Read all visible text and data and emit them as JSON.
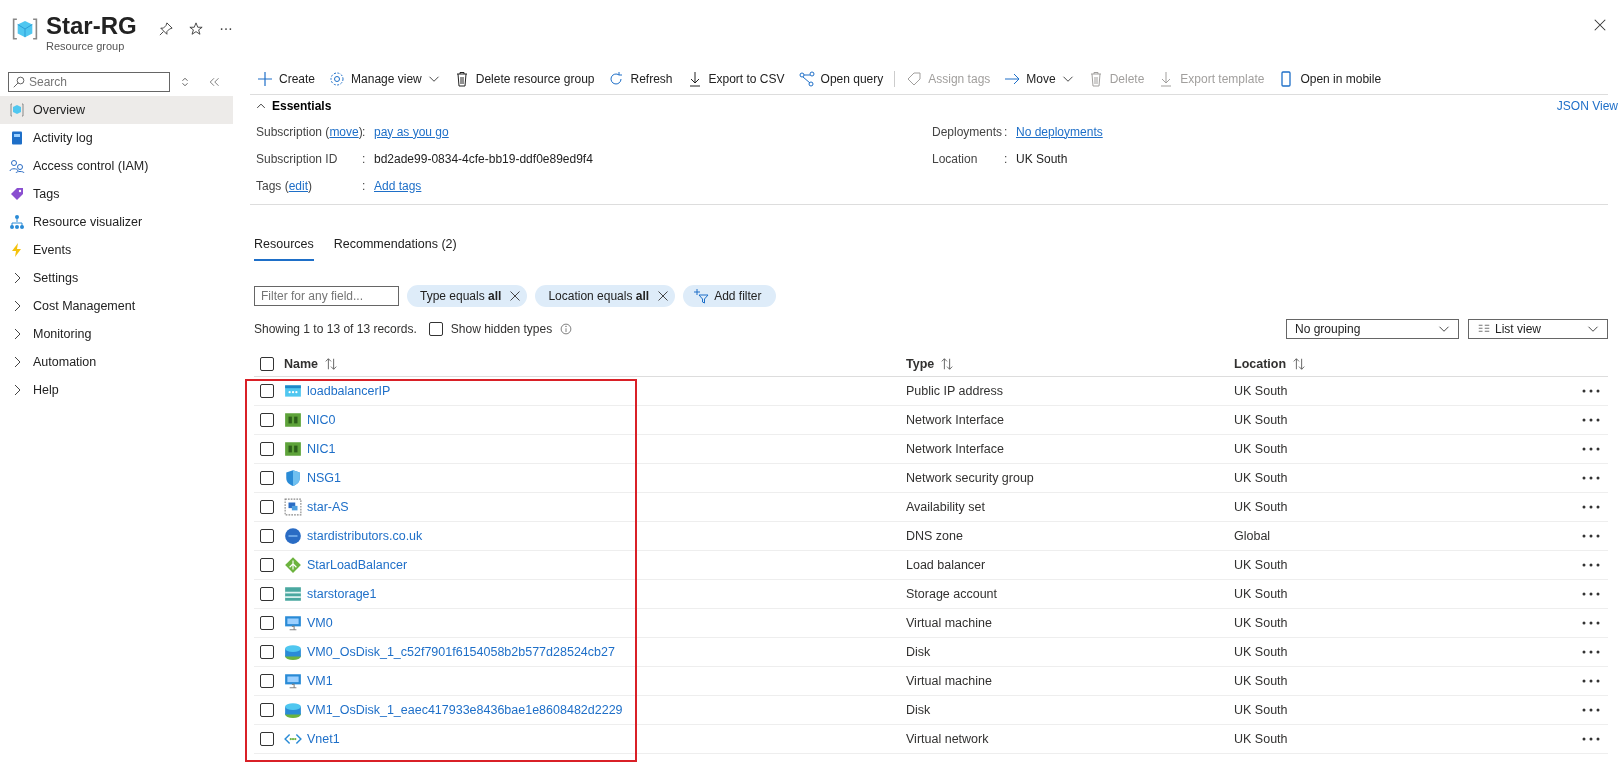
{
  "header": {
    "title": "Star-RG",
    "subtitle": "Resource group"
  },
  "sidebar": {
    "search_placeholder": "Search",
    "items": [
      {
        "label": "Overview",
        "kind": "overview",
        "selected": true
      },
      {
        "label": "Activity log",
        "kind": "log",
        "selected": false
      },
      {
        "label": "Access control (IAM)",
        "kind": "iam",
        "selected": false
      },
      {
        "label": "Tags",
        "kind": "tag",
        "selected": false
      },
      {
        "label": "Resource visualizer",
        "kind": "visualizer",
        "selected": false
      },
      {
        "label": "Events",
        "kind": "events",
        "selected": false
      },
      {
        "label": "Settings",
        "kind": "group",
        "selected": false
      },
      {
        "label": "Cost Management",
        "kind": "group",
        "selected": false
      },
      {
        "label": "Monitoring",
        "kind": "group",
        "selected": false
      },
      {
        "label": "Automation",
        "kind": "group",
        "selected": false
      },
      {
        "label": "Help",
        "kind": "group",
        "selected": false
      }
    ]
  },
  "toolbar": [
    {
      "label": "Create",
      "kind": "plus",
      "disabled": false,
      "dropdown": false
    },
    {
      "label": "Manage view",
      "kind": "gear",
      "disabled": false,
      "dropdown": true
    },
    {
      "label": "Delete resource group",
      "kind": "trash",
      "disabled": false,
      "dropdown": false
    },
    {
      "label": "Refresh",
      "kind": "refresh",
      "disabled": false,
      "dropdown": false
    },
    {
      "label": "Export to CSV",
      "kind": "download",
      "disabled": false,
      "dropdown": false
    },
    {
      "label": "Open query",
      "kind": "query",
      "disabled": false,
      "dropdown": false
    },
    {
      "label": "Assign tags",
      "kind": "tag",
      "disabled": true,
      "dropdown": false
    },
    {
      "label": "Move",
      "kind": "arrow",
      "disabled": false,
      "dropdown": true
    },
    {
      "label": "Delete",
      "kind": "trash",
      "disabled": true,
      "dropdown": false
    },
    {
      "label": "Export template",
      "kind": "download",
      "disabled": true,
      "dropdown": false
    },
    {
      "label": "Open in mobile",
      "kind": "mobile",
      "disabled": false,
      "dropdown": false
    }
  ],
  "essentials": {
    "title": "Essentials",
    "json_view": "JSON View",
    "left": [
      {
        "label": "Subscription (",
        "label_link": "move",
        "label_suffix": ")",
        "sep": ":",
        "value": "pay as you go",
        "value_link": true
      },
      {
        "label": "Subscription ID",
        "sep": ":",
        "value": "bd2ade99-0834-4cfe-bb19-ddf0e89ed9f4",
        "value_link": false
      },
      {
        "label": "Tags (",
        "label_link": "edit",
        "label_suffix": ")",
        "sep": ":",
        "value": "Add tags",
        "value_link": true
      }
    ],
    "right": [
      {
        "label": "Deployments",
        "sep": ":",
        "value": "No deployments",
        "value_link": true
      },
      {
        "label": "Location",
        "sep": ":",
        "value": "UK South",
        "value_link": false
      }
    ]
  },
  "tabs": [
    {
      "label": "Resources",
      "selected": true
    },
    {
      "label": "Recommendations (2)",
      "selected": false
    }
  ],
  "filter": {
    "placeholder": "Filter for any field...",
    "chips": [
      "Type equals **all**",
      "Location equals **all**"
    ],
    "add_filter": "Add filter"
  },
  "records": {
    "text": "Showing 1 to 13 of 13 records.",
    "show_hidden": {
      "label": "Show hidden types",
      "checked": false
    }
  },
  "grouping": "No grouping",
  "view": "List view",
  "table": {
    "highlight_frame": true,
    "all_checked": false,
    "columns": [
      "Name",
      "Type",
      "Location"
    ],
    "rows": [
      {
        "name": "loadbalancerIP",
        "kind": "ip",
        "type": "Public IP address",
        "location": "UK South",
        "checked": false
      },
      {
        "name": "NIC0",
        "kind": "nic",
        "type": "Network Interface",
        "location": "UK South",
        "checked": false
      },
      {
        "name": "NIC1",
        "kind": "nic",
        "type": "Network Interface",
        "location": "UK South",
        "checked": false
      },
      {
        "name": "NSG1",
        "kind": "shield",
        "type": "Network security group",
        "location": "UK South",
        "checked": false
      },
      {
        "name": "star-AS",
        "kind": "avset",
        "type": "Availability set",
        "location": "UK South",
        "checked": false
      },
      {
        "name": "stardistributors.co.uk",
        "kind": "dns",
        "type": "DNS zone",
        "location": "Global",
        "checked": false
      },
      {
        "name": "StarLoadBalancer",
        "kind": "lb",
        "type": "Load balancer",
        "location": "UK South",
        "checked": false
      },
      {
        "name": "starstorage1",
        "kind": "storage",
        "type": "Storage account",
        "location": "UK South",
        "checked": false
      },
      {
        "name": "VM0",
        "kind": "vm",
        "type": "Virtual machine",
        "location": "UK South",
        "checked": false
      },
      {
        "name": "VM0_OsDisk_1_c52f7901f6154058b2b577d28524cb27",
        "kind": "disk",
        "type": "Disk",
        "location": "UK South",
        "checked": false
      },
      {
        "name": "VM1",
        "kind": "vm",
        "type": "Virtual machine",
        "location": "UK South",
        "checked": false
      },
      {
        "name": "VM1_OsDisk_1_eaec417933e8436bae1e8608482d2229",
        "kind": "disk",
        "type": "Disk",
        "location": "UK South",
        "checked": false
      },
      {
        "name": "Vnet1",
        "kind": "vnet",
        "type": "Virtual network",
        "location": "UK South",
        "checked": false
      }
    ]
  }
}
